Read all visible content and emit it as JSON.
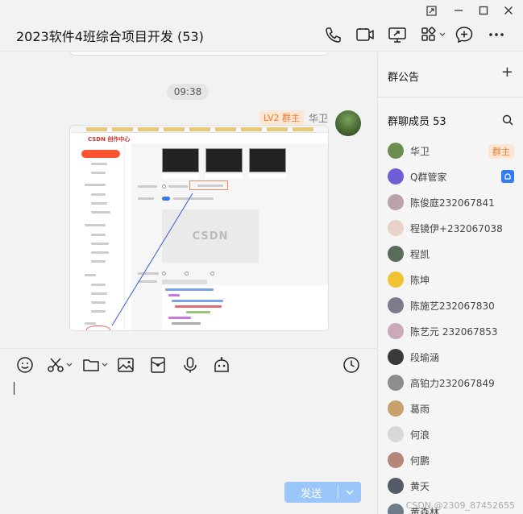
{
  "window": {
    "controls": [
      "pin-icon",
      "minimize-icon",
      "maximize-icon",
      "close-icon"
    ]
  },
  "header": {
    "title": "2023软件4班综合项目开发 (53)",
    "icons": [
      "phone-icon",
      "video-call-icon",
      "screen-share-icon",
      "apps-icon",
      "add-chat-icon",
      "more-icon"
    ]
  },
  "chat": {
    "time": "09:38",
    "message": {
      "badge": "LV2 群主",
      "sender": "华卫",
      "content_type": "image"
    },
    "screenshot": {
      "logo": "CSDN 创作中心",
      "preview_logo": "CSDN"
    }
  },
  "toolbar": {
    "icons": [
      "emoji-icon",
      "scissors-icon",
      "folder-icon",
      "image-icon",
      "red-packet-icon",
      "microphone-icon",
      "robot-icon",
      "history-icon"
    ]
  },
  "composer": {
    "send_label": "发送"
  },
  "panel": {
    "announcement_title": "群公告",
    "members_title": "群聊成员 53",
    "owner_badge": "群主",
    "members": [
      {
        "name": "华卫",
        "color": "#6b8e4e",
        "role": "owner"
      },
      {
        "name": "Q群管家",
        "color": "#6f5fd6",
        "role": "bot"
      },
      {
        "name": "陈俊庭232067841",
        "color": "#b9a2a8",
        "role": ""
      },
      {
        "name": "程镜伊+232067038",
        "color": "#e9d3c9",
        "role": ""
      },
      {
        "name": "程凯",
        "color": "#5b6b5a",
        "role": ""
      },
      {
        "name": "陈坤",
        "color": "#f1c232",
        "role": ""
      },
      {
        "name": "陈施艺232067830",
        "color": "#7d7a8c",
        "role": ""
      },
      {
        "name": "陈艺元 232067853",
        "color": "#caa9b8",
        "role": ""
      },
      {
        "name": "段瑜涵",
        "color": "#3a3a3a",
        "role": ""
      },
      {
        "name": "高铂力232067849",
        "color": "#8d8d8d",
        "role": ""
      },
      {
        "name": "葛雨",
        "color": "#c9a06a",
        "role": ""
      },
      {
        "name": "何浪",
        "color": "#d8d8d8",
        "role": ""
      },
      {
        "name": "何鹏",
        "color": "#b7867a",
        "role": ""
      },
      {
        "name": "黄天",
        "color": "#555b66",
        "role": ""
      },
      {
        "name": "黄森林",
        "color": "#6f7d8a",
        "role": ""
      }
    ]
  },
  "watermark": "CSDN @2309_87452655"
}
